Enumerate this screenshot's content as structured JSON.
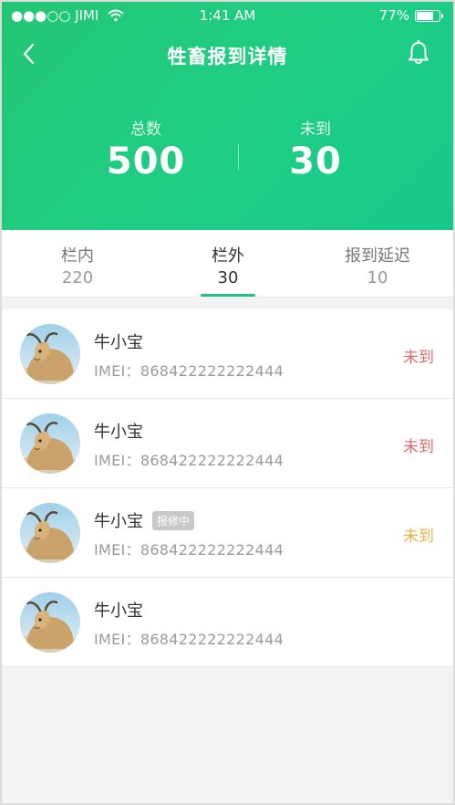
{
  "status_bar": {
    "carrier": "●●●○○ JIMI",
    "time": "1:41 AM",
    "battery_text": "77%",
    "battery_level": 0.77
  },
  "header": {
    "title": "牲畜报到详情",
    "back_icon": "chevron-left-icon",
    "bell_icon": "bell-icon"
  },
  "stats": {
    "total_label": "总数",
    "total_value": "500",
    "missing_label": "未到",
    "missing_value": "30"
  },
  "tabs": [
    {
      "label": "栏内",
      "count": "220",
      "active": false
    },
    {
      "label": "栏外",
      "count": "30",
      "active": true
    },
    {
      "label": "报到延迟",
      "count": "10",
      "active": false
    }
  ],
  "list": [
    {
      "name": "牛小宝",
      "imei": "IMEI：868422222222444",
      "badge": "",
      "status": "未到",
      "status_color": "#e06b6b"
    },
    {
      "name": "牛小宝",
      "imei": "IMEI：868422222222444",
      "badge": "",
      "status": "未到",
      "status_color": "#e06b6b"
    },
    {
      "name": "牛小宝",
      "imei": "IMEI：868422222222444",
      "badge": "报修中",
      "status": "未到",
      "status_color": "#f0b04a"
    },
    {
      "name": "牛小宝",
      "imei": "IMEI：868422222222444",
      "badge": "",
      "status": "",
      "status_color": "#e06b6b"
    }
  ],
  "colors": {
    "brand_green": "#1fc47a",
    "missing_red": "#e06b6b",
    "delay_orange": "#f0b04a"
  }
}
